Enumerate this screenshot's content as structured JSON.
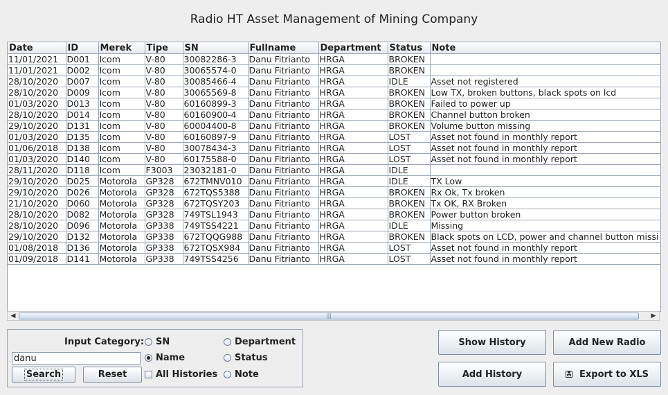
{
  "window": {
    "title": "Radio HT Asset Management of Mining Company"
  },
  "table": {
    "columns": [
      "Date",
      "ID",
      "Merek",
      "Tipe",
      "SN",
      "Fullname",
      "Department",
      "Status",
      "Note"
    ],
    "rows": [
      [
        "11/01/2021",
        "D001",
        "Icom",
        "V-80",
        "30082286-3",
        "Danu Fitrianto",
        "HRGA",
        "BROKEN",
        ""
      ],
      [
        "11/01/2021",
        "D002",
        "Icom",
        "V-80",
        "30065574-0",
        "Danu Fitrianto",
        "HRGA",
        "BROKEN",
        ""
      ],
      [
        "28/10/2020",
        "D007",
        "Icom",
        "V-80",
        "30085466-4",
        "Danu Fitrianto",
        "HRGA",
        "IDLE",
        "Asset not registered"
      ],
      [
        "28/10/2020",
        "D009",
        "Icom",
        "V-80",
        "30065569-8",
        "Danu Fitrianto",
        "HRGA",
        "BROKEN",
        "Low TX, broken buttons, black spots on lcd"
      ],
      [
        "01/03/2020",
        "D013",
        "Icom",
        "V-80",
        "60160899-3",
        "Danu Fitrianto",
        "HRGA",
        "BROKEN",
        "Failed to power up"
      ],
      [
        "28/10/2020",
        "D014",
        "Icom",
        "V-80",
        "60160900-4",
        "Danu Fitrianto",
        "HRGA",
        "BROKEN",
        "Channel button broken"
      ],
      [
        "29/10/2020",
        "D131",
        "Icom",
        "V-80",
        "60004400-8",
        "Danu Fitrianto",
        "HRGA",
        "BROKEN",
        "Volume button missing"
      ],
      [
        "01/03/2020",
        "D135",
        "Icom",
        "V-80",
        "60160897-9",
        "Danu Fitrianto",
        "HRGA",
        "LOST",
        "Asset not found in monthly report"
      ],
      [
        "01/06/2018",
        "D138",
        "Icom",
        "V-80",
        "30078434-3",
        "Danu Fitrianto",
        "HRGA",
        "LOST",
        "Asset not found in monthly report"
      ],
      [
        "01/03/2020",
        "D140",
        "Icom",
        "V-80",
        "60175588-0",
        "Danu Fitrianto",
        "HRGA",
        "LOST",
        "Asset not found in monthly report"
      ],
      [
        "28/11/2020",
        "D118",
        "Icom",
        "F3003",
        "23032181-0",
        "Danu Fitrianto",
        "HRGA",
        "IDLE",
        ""
      ],
      [
        "29/10/2020",
        "D025",
        "Motorola",
        "GP328",
        "672TMNV010",
        "Danu Fitrianto",
        "HRGA",
        "IDLE",
        "TX Low"
      ],
      [
        "29/10/2020",
        "D026",
        "Motorola",
        "GP328",
        "672TQS5388",
        "Danu Fitrianto",
        "HRGA",
        "BROKEN",
        "Rx Ok, Tx broken"
      ],
      [
        "21/10/2020",
        "D060",
        "Motorola",
        "GP328",
        "672TQSY203",
        "Danu Fitrianto",
        "HRGA",
        "BROKEN",
        "Tx OK, RX Broken"
      ],
      [
        "28/10/2020",
        "D082",
        "Motorola",
        "GP328",
        "749TSL1943",
        "Danu Fitrianto",
        "HRGA",
        "BROKEN",
        "Power button broken"
      ],
      [
        "28/10/2020",
        "D096",
        "Motorola",
        "GP338",
        "749TSS4221",
        "Danu Fitrianto",
        "HRGA",
        "IDLE",
        "Missing"
      ],
      [
        "29/10/2020",
        "D132",
        "Motorola",
        "GP338",
        "672TQQG988",
        "Danu Fitrianto",
        "HRGA",
        "BROKEN",
        "Black spots on LCD, power and channel button missi"
      ],
      [
        "01/08/2018",
        "D136",
        "Motorola",
        "GP338",
        "672TQSX984",
        "Danu Fitrianto",
        "HRGA",
        "LOST",
        "Asset not found in monthly report"
      ],
      [
        "01/09/2018",
        "D141",
        "Motorola",
        "GP338",
        "749TSS4256",
        "Danu Fitrianto",
        "HRGA",
        "LOST",
        "Asset not found in monthly report"
      ]
    ]
  },
  "search_panel": {
    "category_label": "Input Category:",
    "search_value": "danu",
    "radios": {
      "sn": "SN",
      "name": "Name",
      "department": "Department",
      "status": "Status",
      "note": "Note"
    },
    "selected": "Name",
    "all_histories_label": "All Histories",
    "search_label": "Search",
    "reset_label": "Reset"
  },
  "actions": {
    "show_history": "Show History",
    "add_new_radio": "Add New Radio",
    "add_history": "Add History",
    "export_xls": "Export to XLS"
  },
  "icons": {
    "export": "save-disk-icon",
    "scroll_left": "arrow-left-icon",
    "scroll_right": "arrow-right-icon",
    "thumb_grip": "grip-icon"
  }
}
